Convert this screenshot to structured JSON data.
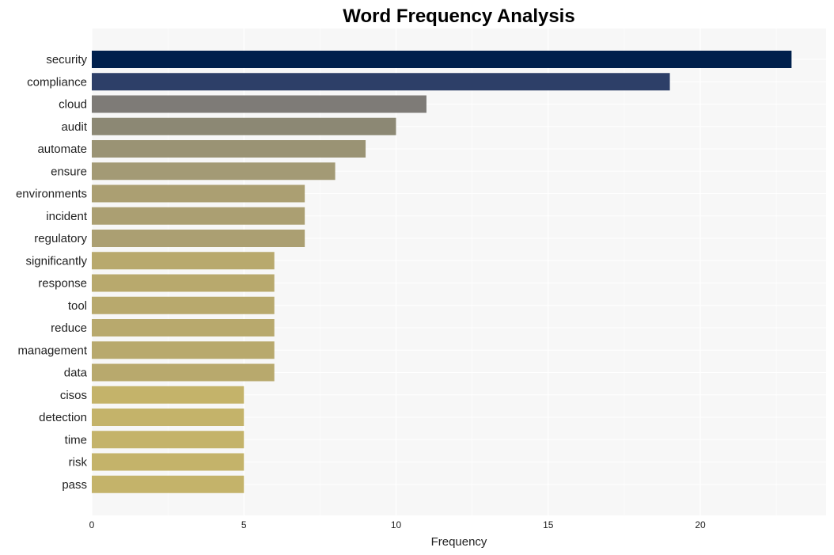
{
  "chart_data": {
    "type": "bar",
    "orientation": "horizontal",
    "title": "Word Frequency Analysis",
    "xlabel": "Frequency",
    "ylabel": "",
    "xlim": [
      0,
      24.2
    ],
    "xticks": [
      0,
      5,
      10,
      15,
      20
    ],
    "grid": true,
    "categories": [
      "security",
      "compliance",
      "cloud",
      "audit",
      "automate",
      "ensure",
      "environments",
      "incident",
      "regulatory",
      "significantly",
      "response",
      "tool",
      "reduce",
      "management",
      "data",
      "cisos",
      "detection",
      "time",
      "risk",
      "pass"
    ],
    "values": [
      23,
      19,
      11,
      10,
      9,
      8,
      7,
      7,
      7,
      6,
      6,
      6,
      6,
      6,
      6,
      5,
      5,
      5,
      5,
      5
    ],
    "colors": [
      "#00204c",
      "#2d3f68",
      "#7e7b77",
      "#8c8874",
      "#9a9374",
      "#a39a75",
      "#ab9f72",
      "#ab9f72",
      "#ab9f72",
      "#b8a96d",
      "#b8a96d",
      "#b8a96d",
      "#b8a96d",
      "#b8a96d",
      "#b8a96d",
      "#c4b36a",
      "#c4b36a",
      "#c4b36a",
      "#c4b36a",
      "#c4b36a"
    ],
    "panel_background": "#f7f7f7",
    "gridline_color": "#ffffff"
  }
}
